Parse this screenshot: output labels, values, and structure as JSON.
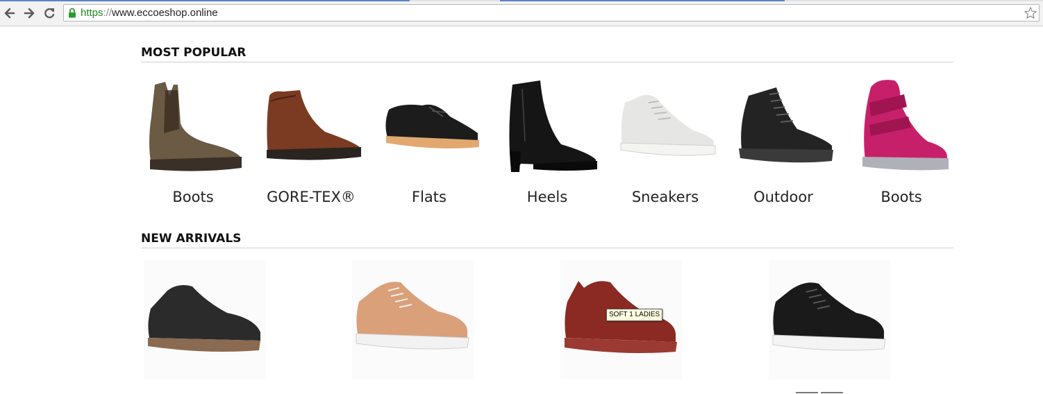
{
  "browser": {
    "url_scheme": "https",
    "url_separator": "://",
    "url_host": "www.eccoeshop.online",
    "icons": [
      "back-icon",
      "forward-icon",
      "reload-icon",
      "lock-icon",
      "bookmark-star-icon"
    ]
  },
  "most_popular": {
    "title": "MOST POPULAR",
    "categories": [
      {
        "label": "Boots",
        "color": "#6b5a44"
      },
      {
        "label": "GORE-TEX®",
        "color": "#7a3b22"
      },
      {
        "label": "Flats",
        "color": "#1c1c1c"
      },
      {
        "label": "Heels",
        "color": "#151515"
      },
      {
        "label": "Sneakers",
        "color": "#e6e6e4"
      },
      {
        "label": "Outdoor",
        "color": "#232323"
      },
      {
        "label": "Boots",
        "color": "#c7206a"
      }
    ]
  },
  "new_arrivals": {
    "title": "NEW ARRIVALS",
    "products": [
      {
        "color": "#2b2b2b"
      },
      {
        "color": "#d9a07a"
      },
      {
        "color": "#8a2a22"
      },
      {
        "color": "#1a1a1a"
      }
    ],
    "tooltip": "SOFT 1 LADIES"
  }
}
